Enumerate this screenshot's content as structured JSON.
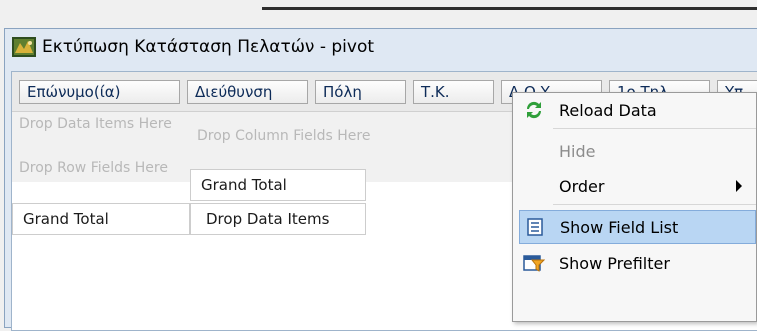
{
  "window": {
    "title": "Εκτύπωση Κατάσταση Πελατών - pivot"
  },
  "fields": [
    {
      "label": "Επώνυμο(ία)"
    },
    {
      "label": "Διεύθυνση"
    },
    {
      "label": "Πόλη"
    },
    {
      "label": "Τ.Κ."
    },
    {
      "label": "Δ.Ο.Υ."
    },
    {
      "label": "1ο Τηλ."
    },
    {
      "label": "Υπ"
    }
  ],
  "pivot": {
    "drop_data_items": "Drop Data Items Here",
    "drop_column_fields": "Drop Column Fields Here",
    "drop_row_fields": "Drop Row Fields Here",
    "grand_total_col": "Grand Total",
    "grand_total_row": "Grand Total",
    "drop_data_cell": "Drop Data Items"
  },
  "context_menu": {
    "reload": "Reload Data",
    "hide": "Hide",
    "order": "Order",
    "show_field_list": "Show Field List",
    "show_prefilter": "Show Prefilter"
  },
  "icons": {
    "app": "app-icon",
    "reload": "reload-icon",
    "field_list": "field-list-icon",
    "prefilter": "prefilter-icon",
    "submenu": "chevron-right-icon"
  },
  "colors": {
    "highlight": "#b9d6f3",
    "title_bg": "#dfe8f3"
  }
}
